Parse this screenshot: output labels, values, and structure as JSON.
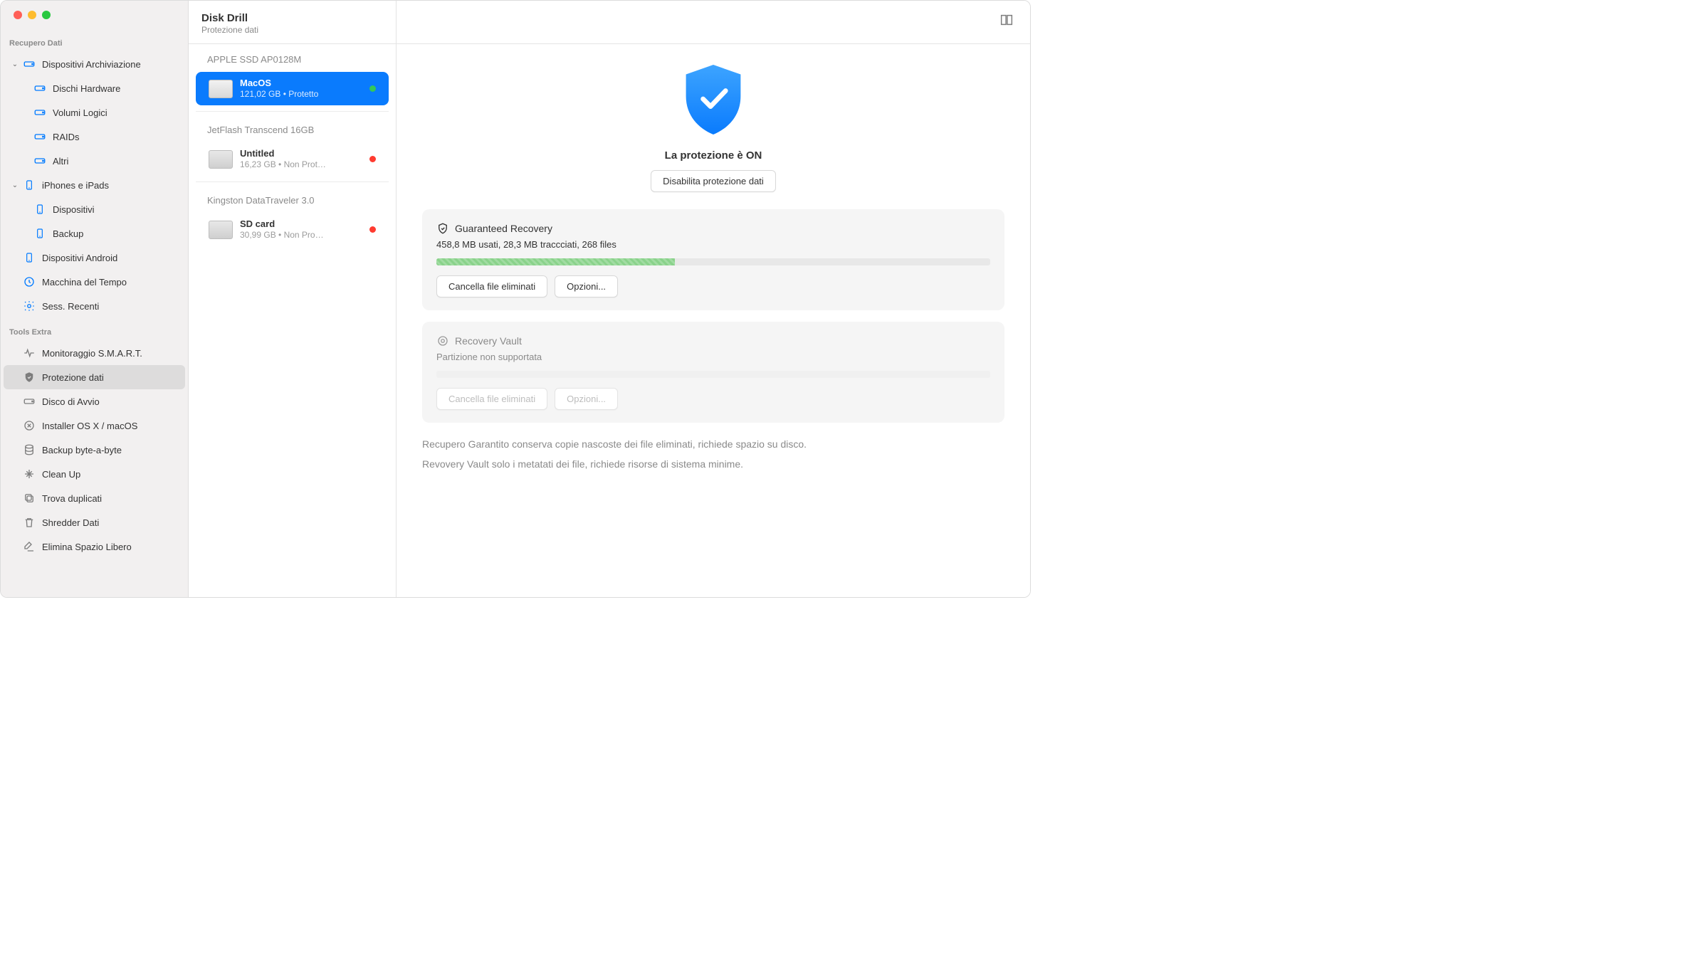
{
  "header": {
    "title": "Disk Drill",
    "subtitle": "Protezione dati"
  },
  "sidebar": {
    "section1": {
      "header": "Recupero Dati"
    },
    "storage": {
      "label": "Dispositivi Archiviazione",
      "items": [
        "Dischi Hardware",
        "Volumi Logici",
        "RAIDs",
        "Altri"
      ]
    },
    "iphones": {
      "label": "iPhones e iPads",
      "items": [
        "Dispositivi",
        "Backup"
      ]
    },
    "android": "Dispositivi Android",
    "timemachine": "Macchina del Tempo",
    "sessions": "Sess. Recenti",
    "section2": {
      "header": "Tools Extra"
    },
    "tools": {
      "smart": "Monitoraggio S.M.A.R.T.",
      "protect": "Protezione dati",
      "boot": "Disco di Avvio",
      "installer": "Installer OS X / macOS",
      "bytebackup": "Backup byte-a-byte",
      "cleanup": "Clean Up",
      "dup": "Trova duplicati",
      "shred": "Shredder Dati",
      "erase": "Elimina Spazio Libero"
    }
  },
  "devices": {
    "groups": [
      {
        "name": "APPLE SSD AP0128M",
        "items": [
          {
            "name": "MacOS",
            "sub": "121,02 GB • Protetto",
            "status": "green",
            "selected": true
          }
        ]
      },
      {
        "name": "JetFlash Transcend 16GB",
        "items": [
          {
            "name": "Untitled",
            "sub": "16,23 GB • Non Prot…",
            "status": "red"
          }
        ]
      },
      {
        "name": "Kingston DataTraveler 3.0",
        "items": [
          {
            "name": "SD card",
            "sub": "30,99 GB • Non Pro…",
            "status": "red"
          }
        ]
      }
    ]
  },
  "main": {
    "hero_title": "La protezione è ON",
    "disable_btn": "Disabilita protezione dati",
    "panel1": {
      "title": "Guaranteed Recovery",
      "sub": "458,8 MB usati, 28,3 MB traccciati, 268 files",
      "progress": 43,
      "btn1": "Cancella file eliminati",
      "btn2": "Opzioni..."
    },
    "panel2": {
      "title": "Recovery Vault",
      "sub": "Partizione non supportata",
      "btn1": "Cancella file eliminati",
      "btn2": "Opzioni..."
    },
    "footnote1": "Recupero Garantito conserva copie nascoste dei file eliminati, richiede spazio su disco.",
    "footnote2": "Revovery Vault solo i metatati dei file, richiede risorse di sistema minime."
  }
}
